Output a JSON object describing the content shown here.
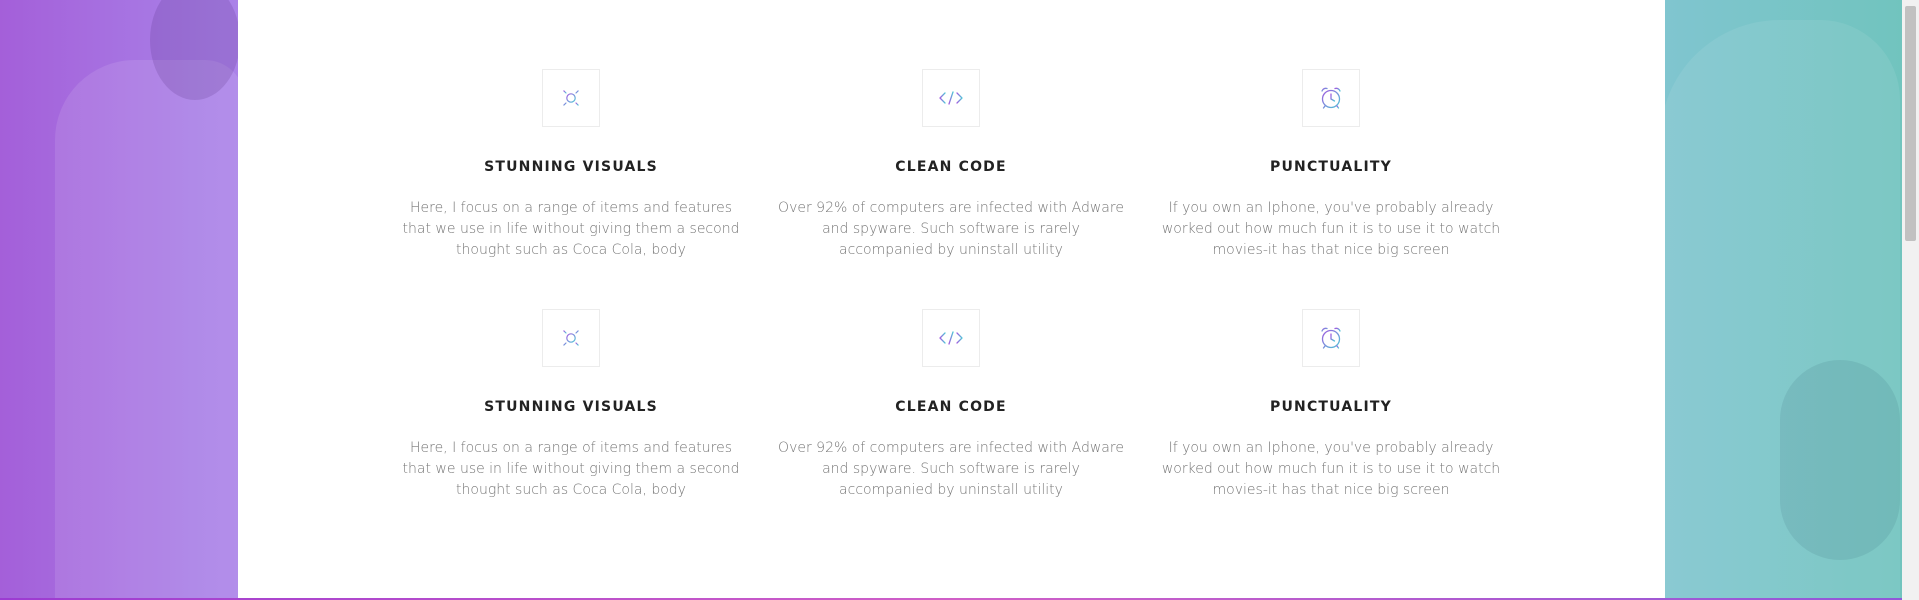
{
  "features": [
    {
      "icon": "sun-icon",
      "title": "STUNNING VISUALS",
      "description": "Here, I focus on a range of items and features that we use in life without giving them a second thought such as Coca Cola, body"
    },
    {
      "icon": "code-icon",
      "title": "CLEAN CODE",
      "description": "Over 92% of computers are infected with Adware and spyware. Such software is rarely accompanied by uninstall utility"
    },
    {
      "icon": "alarm-clock-icon",
      "title": "PUNCTUALITY",
      "description": "If you own an Iphone, you've probably already worked out how much fun it is to use it to watch movies-it has that nice big screen"
    },
    {
      "icon": "sun-icon",
      "title": "STUNNING VISUALS",
      "description": "Here, I focus on a range of items and features that we use in life without giving them a second thought such as Coca Cola, body"
    },
    {
      "icon": "code-icon",
      "title": "CLEAN CODE",
      "description": "Over 92% of computers are infected with Adware and spyware. Such software is rarely accompanied by uninstall utility"
    },
    {
      "icon": "alarm-clock-icon",
      "title": "PUNCTUALITY",
      "description": "If you own an Iphone, you've probably already worked out how much fun it is to use it to watch movies-it has that nice big screen"
    }
  ],
  "colors": {
    "icon_gradient_start": "#a25be0",
    "icon_gradient_end": "#4fc7d6",
    "title": "#222222",
    "description": "#777777"
  }
}
